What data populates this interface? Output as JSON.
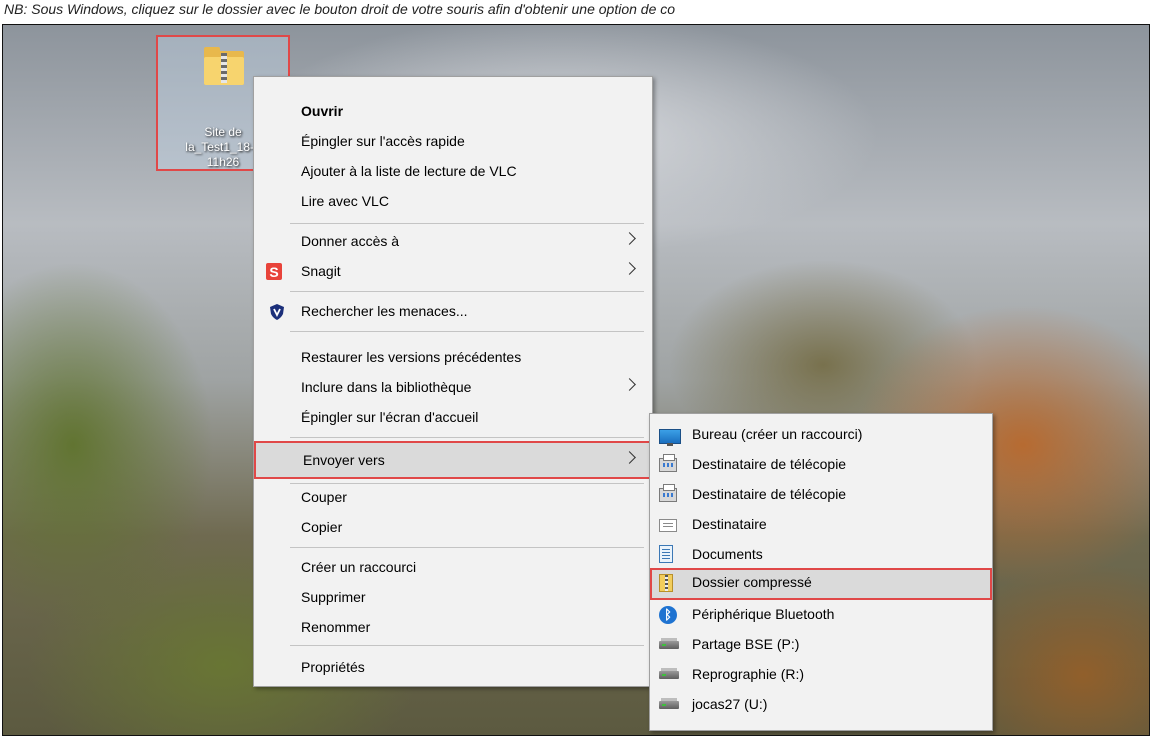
{
  "caption": "NB: Sous Windows, cliquez sur le dossier avec le bouton droit de votre souris afin d'obtenir une option de co",
  "desktop_icon": {
    "icon": "zipped-folder-icon",
    "label_lines": [
      "Site de",
      "la_Test1_18-0",
      "11h26"
    ]
  },
  "context_menu": {
    "items": [
      {
        "label": "Ouvrir"
      },
      {
        "label": "Épingler sur l'accès rapide"
      },
      {
        "label": "Ajouter à la liste de lecture de VLC"
      },
      {
        "label": "Lire avec VLC"
      },
      {
        "label": "Donner accès à"
      },
      {
        "label": "Snagit",
        "icon_text": "S"
      },
      {
        "label": "Rechercher les menaces..."
      },
      {
        "label": "Restaurer les versions précédentes"
      },
      {
        "label": "Inclure dans la bibliothèque"
      },
      {
        "label": "Épingler sur l'écran d'accueil"
      },
      {
        "label": "Envoyer vers"
      },
      {
        "label": "Couper"
      },
      {
        "label": "Copier"
      },
      {
        "label": "Créer un raccourci"
      },
      {
        "label": "Supprimer"
      },
      {
        "label": "Renommer"
      },
      {
        "label": "Propriétés"
      }
    ]
  },
  "send_to_menu": {
    "items": [
      {
        "label": "Bureau (créer un raccourci)"
      },
      {
        "label": "Destinataire de télécopie"
      },
      {
        "label": "Destinataire de télécopie"
      },
      {
        "label": "Destinataire"
      },
      {
        "label": "Documents"
      },
      {
        "label": "Dossier compressé"
      },
      {
        "label": "Périphérique Bluetooth",
        "icon_text": "ᛒ"
      },
      {
        "label": "Partage BSE (P:)"
      },
      {
        "label": "Reprographie (R:)"
      },
      {
        "label": "jocas27 (U:)"
      }
    ]
  },
  "colors": {
    "highlight_border": "#e04848",
    "menu_background": "#f2f2f2",
    "hover_background": "#dadada"
  }
}
